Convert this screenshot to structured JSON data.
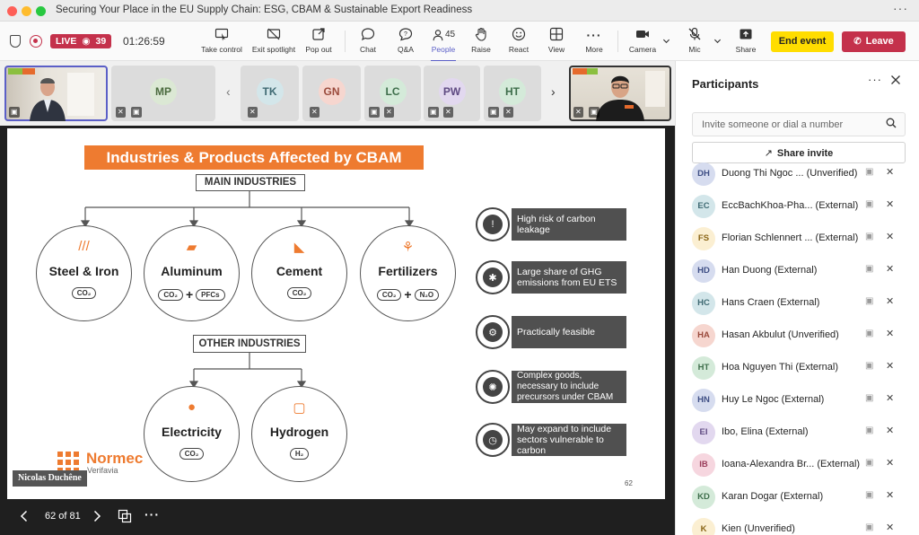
{
  "window": {
    "title": "Securing Your Place in the EU Supply Chain: ESG, CBAM & Sustainable Export Readiness"
  },
  "toolbar": {
    "live_label": "LIVE",
    "viewers": "39",
    "timer": "01:26:59",
    "buttons": [
      {
        "label": "Take control",
        "icon": "take-control-icon"
      },
      {
        "label": "Exit spotlight",
        "icon": "spotlight-icon"
      },
      {
        "label": "Pop out",
        "icon": "pop-out-icon"
      },
      {
        "label": "Chat",
        "icon": "chat-icon"
      },
      {
        "label": "Q&A",
        "icon": "qa-icon"
      },
      {
        "label": "People",
        "icon": "people-icon",
        "count": "45"
      },
      {
        "label": "Raise",
        "icon": "raise-hand-icon"
      },
      {
        "label": "React",
        "icon": "react-icon"
      },
      {
        "label": "View",
        "icon": "view-icon"
      },
      {
        "label": "More",
        "icon": "more-icon"
      },
      {
        "label": "Camera",
        "icon": "camera-icon"
      },
      {
        "label": "Mic",
        "icon": "mic-off-icon"
      },
      {
        "label": "Share",
        "icon": "share-icon"
      }
    ],
    "end_event": "End event",
    "leave": "Leave"
  },
  "stage": {
    "thumbnails": [
      {
        "initials": "MP",
        "bg": "#dbe8d4",
        "fg": "#4b6b3f"
      },
      {
        "initials": "TK",
        "bg": "#d3e6ea",
        "fg": "#3f6a73"
      },
      {
        "initials": "GN",
        "bg": "#f6d6cf",
        "fg": "#9a4a3c"
      },
      {
        "initials": "LC",
        "bg": "#d4ead9",
        "fg": "#3e6e4b"
      },
      {
        "initials": "PW",
        "bg": "#e2d8ef",
        "fg": "#5f4a82"
      },
      {
        "initials": "HT",
        "bg": "#d4ead9",
        "fg": "#3e6e4b"
      }
    ],
    "presenter_name": "Nicolas Duchêne",
    "nav": {
      "page": "62 of 81"
    }
  },
  "slide": {
    "title": "Industries & Products Affected by CBAM",
    "main_industries": "MAIN INDUSTRIES",
    "other_industries": "OTHER INDUSTRIES",
    "industries": [
      {
        "name": "Steel & Iron",
        "gases": [
          "CO₂"
        ]
      },
      {
        "name": "Aluminum",
        "gases": [
          "CO₂",
          "PFCs"
        ]
      },
      {
        "name": "Cement",
        "gases": [
          "CO₂"
        ]
      },
      {
        "name": "Fertilizers",
        "gases": [
          "CO₂",
          "N₂O"
        ]
      },
      {
        "name": "Electricity",
        "gases": [
          "CO₂"
        ]
      },
      {
        "name": "Hydrogen",
        "gases": [
          "H₂"
        ]
      }
    ],
    "criteria": [
      "High risk of carbon leakage",
      "Large share of GHG emissions from EU ETS",
      "Practically feasible",
      "Complex goods, necessary to include precursors under CBAM",
      "May expand to include sectors vulnerable to carbon"
    ],
    "logo": {
      "name": "Normec",
      "sub": "Verifavia"
    },
    "page_number": "62"
  },
  "panel": {
    "title": "Participants",
    "search_placeholder": "Invite someone or dial a number",
    "share_invite": "Share invite",
    "participants": [
      {
        "initials": "DH",
        "name": "Duong Thi Ngoc ... (Unverified)",
        "bg": "#d6dcef",
        "fg": "#3f4f85"
      },
      {
        "initials": "EC",
        "name": "EccBachKhoa-Pha... (External)",
        "bg": "#d3e6ea",
        "fg": "#3f6a73"
      },
      {
        "initials": "FS",
        "name": "Florian Schlennert ... (External)",
        "bg": "#fbefd2",
        "fg": "#8a6516"
      },
      {
        "initials": "HD",
        "name": "Han Duong (External)",
        "bg": "#d6dcef",
        "fg": "#3f4f85"
      },
      {
        "initials": "HC",
        "name": "Hans Craen (External)",
        "bg": "#d3e6ea",
        "fg": "#3f6a73"
      },
      {
        "initials": "HA",
        "name": "Hasan Akbulut (Unverified)",
        "bg": "#f6d6cf",
        "fg": "#9a4a3c"
      },
      {
        "initials": "HT",
        "name": "Hoa Nguyen Thi (External)",
        "bg": "#d4ead9",
        "fg": "#3e6e4b"
      },
      {
        "initials": "HN",
        "name": "Huy Le Ngoc (External)",
        "bg": "#d6dcef",
        "fg": "#3f4f85"
      },
      {
        "initials": "EI",
        "name": "Ibo, Elina (External)",
        "bg": "#e2d8ef",
        "fg": "#5f4a82"
      },
      {
        "initials": "IB",
        "name": "Ioana-Alexandra Br... (External)",
        "bg": "#f6d6df",
        "fg": "#9a3c5a"
      },
      {
        "initials": "KD",
        "name": "Karan Dogar (External)",
        "bg": "#d4ead9",
        "fg": "#3e6e4b"
      },
      {
        "initials": "K",
        "name": "Kien (Unverified)",
        "bg": "#fbefd2",
        "fg": "#8a6516"
      }
    ]
  }
}
